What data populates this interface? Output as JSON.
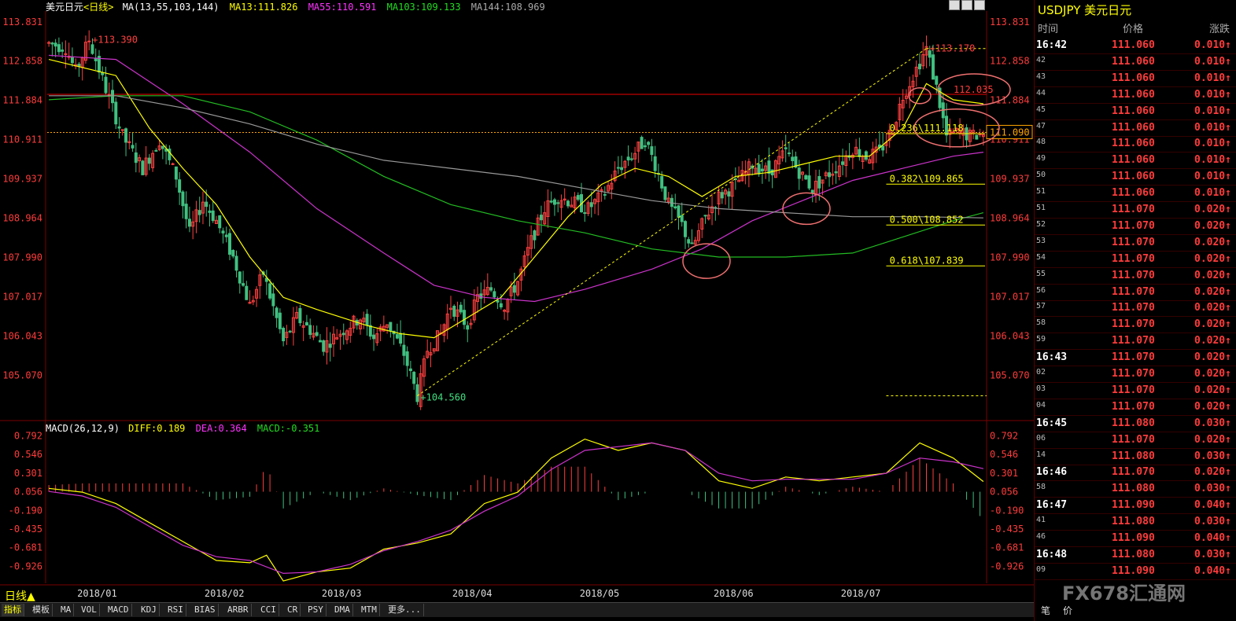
{
  "header": {
    "title": "美元日元",
    "period_tag": "<日线>",
    "ma_label": "MA(13,55,103,144)",
    "ma13": "MA13:111.826",
    "ma55": "MA55:110.591",
    "ma103": "MA103:109.133",
    "ma144": "MA144:108.969"
  },
  "macd_header": {
    "label": "MACD(26,12,9)",
    "diff": "DIFF:0.189",
    "dea": "DEA:0.364",
    "macd": "MACD:-0.351"
  },
  "colors": {
    "up": "#ff4040",
    "down": "#40c080",
    "ma13": "#ffff00",
    "ma55": "#cc33cc",
    "ma103": "#22bb22",
    "ma144": "#999999",
    "fib": "#ffff00",
    "axis": "#ff3b3b"
  },
  "period_button": "日线▲",
  "bottom_tabs": [
    "指标",
    "模板",
    "MA",
    "VOL",
    "MACD",
    "KDJ",
    "RSI",
    "BIAS",
    "ARBR",
    "CCI",
    "CR",
    "PSY",
    "DMA",
    "MTM",
    "更多..."
  ],
  "right_panel": {
    "symbol": "USDJPY 美元日元",
    "head_time": "时间",
    "head_price": "价格",
    "head_change": "涨跌",
    "ticks": [
      {
        "time": "16:42",
        "price": "111.060",
        "chg": "0.010↑",
        "major": true
      },
      {
        "time": "42",
        "price": "111.060",
        "chg": "0.010↑"
      },
      {
        "time": "43",
        "price": "111.060",
        "chg": "0.010↑"
      },
      {
        "time": "44",
        "price": "111.060",
        "chg": "0.010↑"
      },
      {
        "time": "45",
        "price": "111.060",
        "chg": "0.010↑"
      },
      {
        "time": "47",
        "price": "111.060",
        "chg": "0.010↑"
      },
      {
        "time": "48",
        "price": "111.060",
        "chg": "0.010↑"
      },
      {
        "time": "49",
        "price": "111.060",
        "chg": "0.010↑"
      },
      {
        "time": "50",
        "price": "111.060",
        "chg": "0.010↑"
      },
      {
        "time": "51",
        "price": "111.060",
        "chg": "0.010↑"
      },
      {
        "time": "51",
        "price": "111.070",
        "chg": "0.020↑"
      },
      {
        "time": "52",
        "price": "111.070",
        "chg": "0.020↑"
      },
      {
        "time": "53",
        "price": "111.070",
        "chg": "0.020↑"
      },
      {
        "time": "54",
        "price": "111.070",
        "chg": "0.020↑"
      },
      {
        "time": "55",
        "price": "111.070",
        "chg": "0.020↑"
      },
      {
        "time": "56",
        "price": "111.070",
        "chg": "0.020↑"
      },
      {
        "time": "57",
        "price": "111.070",
        "chg": "0.020↑"
      },
      {
        "time": "58",
        "price": "111.070",
        "chg": "0.020↑"
      },
      {
        "time": "59",
        "price": "111.070",
        "chg": "0.020↑"
      },
      {
        "time": "16:43",
        "price": "111.070",
        "chg": "0.020↑",
        "major": true
      },
      {
        "time": "02",
        "price": "111.070",
        "chg": "0.020↑"
      },
      {
        "time": "03",
        "price": "111.070",
        "chg": "0.020↑"
      },
      {
        "time": "04",
        "price": "111.070",
        "chg": "0.020↑"
      },
      {
        "time": "16:45",
        "price": "111.080",
        "chg": "0.030↑",
        "major": true
      },
      {
        "time": "06",
        "price": "111.070",
        "chg": "0.020↑"
      },
      {
        "time": "14",
        "price": "111.080",
        "chg": "0.030↑"
      },
      {
        "time": "16:46",
        "price": "111.070",
        "chg": "0.020↑",
        "major": true
      },
      {
        "time": "58",
        "price": "111.080",
        "chg": "0.030↑"
      },
      {
        "time": "16:47",
        "price": "111.090",
        "chg": "0.040↑",
        "major": true
      },
      {
        "time": "41",
        "price": "111.080",
        "chg": "0.030↑"
      },
      {
        "time": "46",
        "price": "111.090",
        "chg": "0.040↑"
      },
      {
        "time": "16:48",
        "price": "111.080",
        "chg": "0.030↑",
        "major": true
      },
      {
        "time": "09",
        "price": "111.090",
        "chg": "0.040↑"
      }
    ],
    "bottom_left": "笔",
    "bottom_right": "价"
  },
  "watermark": "FX678汇通网",
  "chart_data": [
    {
      "type": "candlestick",
      "title": "美元日元<日线>",
      "y_ticks": [
        113.831,
        112.858,
        111.884,
        110.911,
        109.937,
        108.964,
        107.99,
        107.017,
        106.043,
        105.07
      ],
      "ylim": [
        104.2,
        114.1
      ],
      "x_ticks": [
        "2018/01",
        "2018/02",
        "2018/03",
        "2018/04",
        "2018/05",
        "2018/06",
        "2018/07"
      ],
      "x_tick_index": [
        5,
        43,
        78,
        117,
        155,
        195,
        233
      ],
      "n_bars": 268,
      "bar_colors": {
        "up": "#ff4040",
        "down": "#40c080"
      },
      "path": [
        [
          0,
          113.3
        ],
        [
          5,
          113.2
        ],
        [
          8,
          112.6
        ],
        [
          12,
          113.39
        ],
        [
          16,
          112.4
        ],
        [
          22,
          111.0
        ],
        [
          28,
          110.2
        ],
        [
          33,
          110.9
        ],
        [
          38,
          110.0
        ],
        [
          42,
          108.6
        ],
        [
          46,
          109.4
        ],
        [
          50,
          108.9
        ],
        [
          55,
          108.0
        ],
        [
          60,
          106.8
        ],
        [
          64,
          107.6
        ],
        [
          70,
          105.9
        ],
        [
          74,
          106.5
        ],
        [
          78,
          106.2
        ],
        [
          82,
          105.8
        ],
        [
          88,
          106.2
        ],
        [
          93,
          106.5
        ],
        [
          97,
          106.0
        ],
        [
          101,
          106.4
        ],
        [
          106,
          105.6
        ],
        [
          110,
          104.56
        ],
        [
          113,
          105.7
        ],
        [
          117,
          106.1
        ],
        [
          120,
          106.8
        ],
        [
          125,
          106.3
        ],
        [
          128,
          107.0
        ],
        [
          132,
          107.2
        ],
        [
          136,
          106.8
        ],
        [
          140,
          107.4
        ],
        [
          144,
          108.4
        ],
        [
          148,
          109.2
        ],
        [
          152,
          109.5
        ],
        [
          158,
          109.3
        ],
        [
          161,
          109.2
        ],
        [
          166,
          109.6
        ],
        [
          170,
          110.2
        ],
        [
          175,
          110.6
        ],
        [
          178,
          110.9
        ],
        [
          181,
          110.3
        ],
        [
          185,
          109.3
        ],
        [
          189,
          108.8
        ],
        [
          192,
          108.2
        ],
        [
          196,
          109.0
        ],
        [
          200,
          109.5
        ],
        [
          205,
          109.8
        ],
        [
          210,
          110.3
        ],
        [
          215,
          110.1
        ],
        [
          220,
          110.6
        ],
        [
          225,
          110.0
        ],
        [
          228,
          109.7
        ],
        [
          232,
          110.0
        ],
        [
          236,
          110.3
        ],
        [
          240,
          110.7
        ],
        [
          244,
          110.5
        ],
        [
          248,
          110.6
        ],
        [
          252,
          111.2
        ],
        [
          255,
          112.0
        ],
        [
          258,
          112.5
        ],
        [
          262,
          113.17
        ],
        [
          265,
          112.2
        ],
        [
          268,
          111.0
        ],
        [
          272,
          111.1
        ],
        [
          275,
          111.0
        ],
        [
          279,
          111.06
        ]
      ],
      "highs_lows_labels": [
        {
          "text": "113.390",
          "value": 113.39,
          "index": 12
        },
        {
          "text": "104.560",
          "value": 104.56,
          "index": 110
        },
        {
          "text": "113.170",
          "value": 113.17,
          "index": 262
        }
      ],
      "current_price_label": "111.090",
      "current_price": 111.09,
      "horizontal_red_line": 112.035,
      "fib_levels": [
        {
          "label": "0.236\\111.118",
          "value": 111.118
        },
        {
          "label": "0.382\\109.865",
          "value": 109.865
        },
        {
          "label": "0.500\\108.852",
          "value": 108.852
        },
        {
          "label": "0.618\\107.839",
          "value": 107.839
        }
      ],
      "fib_base_value": 104.56,
      "annotation_circle_label": "112.035",
      "series": [
        {
          "name": "MA13",
          "color": "#ffff00",
          "values": [
            [
              0,
              112.9
            ],
            [
              20,
              112.5
            ],
            [
              30,
              111.2
            ],
            [
              40,
              110.2
            ],
            [
              50,
              109.3
            ],
            [
              60,
              108.0
            ],
            [
              70,
              107.0
            ],
            [
              80,
              106.7
            ],
            [
              95,
              106.3
            ],
            [
              105,
              106.1
            ],
            [
              115,
              106.0
            ],
            [
              125,
              106.5
            ],
            [
              135,
              107.0
            ],
            [
              145,
              108.0
            ],
            [
              155,
              109.0
            ],
            [
              165,
              109.8
            ],
            [
              175,
              110.2
            ],
            [
              185,
              110.0
            ],
            [
              195,
              109.5
            ],
            [
              205,
              110.0
            ],
            [
              215,
              110.1
            ],
            [
              225,
              110.3
            ],
            [
              235,
              110.5
            ],
            [
              245,
              110.5
            ],
            [
              255,
              111.2
            ],
            [
              262,
              112.3
            ],
            [
              270,
              111.9
            ],
            [
              279,
              111.8
            ]
          ]
        },
        {
          "name": "MA55",
          "color": "#cc33cc",
          "values": [
            [
              0,
              113.0
            ],
            [
              20,
              112.9
            ],
            [
              40,
              111.8
            ],
            [
              60,
              110.6
            ],
            [
              80,
              109.2
            ],
            [
              100,
              108.1
            ],
            [
              115,
              107.3
            ],
            [
              130,
              107.0
            ],
            [
              145,
              106.9
            ],
            [
              160,
              107.2
            ],
            [
              180,
              107.7
            ],
            [
              195,
              108.2
            ],
            [
              210,
              108.9
            ],
            [
              225,
              109.4
            ],
            [
              240,
              109.9
            ],
            [
              255,
              110.2
            ],
            [
              270,
              110.5
            ],
            [
              279,
              110.6
            ]
          ]
        },
        {
          "name": "MA103",
          "color": "#22bb22",
          "values": [
            [
              0,
              111.9
            ],
            [
              20,
              112.0
            ],
            [
              40,
              112.0
            ],
            [
              60,
              111.6
            ],
            [
              80,
              110.9
            ],
            [
              100,
              110.0
            ],
            [
              120,
              109.3
            ],
            [
              140,
              108.9
            ],
            [
              160,
              108.6
            ],
            [
              180,
              108.2
            ],
            [
              200,
              108.0
            ],
            [
              220,
              108.0
            ],
            [
              240,
              108.1
            ],
            [
              255,
              108.5
            ],
            [
              270,
              108.9
            ],
            [
              279,
              109.1
            ]
          ]
        },
        {
          "name": "MA144",
          "color": "#999999",
          "values": [
            [
              0,
              112.0
            ],
            [
              20,
              112.0
            ],
            [
              40,
              111.7
            ],
            [
              60,
              111.3
            ],
            [
              80,
              110.8
            ],
            [
              100,
              110.4
            ],
            [
              120,
              110.2
            ],
            [
              140,
              110.0
            ],
            [
              160,
              109.7
            ],
            [
              180,
              109.4
            ],
            [
              200,
              109.2
            ],
            [
              220,
              109.1
            ],
            [
              240,
              109.0
            ],
            [
              260,
              109.0
            ],
            [
              279,
              108.97
            ]
          ]
        }
      ]
    },
    {
      "type": "macd",
      "title": "MACD(26,12,9)",
      "y_ticks": [
        0.792,
        0.546,
        0.301,
        0.056,
        -0.19,
        -0.435,
        -0.681,
        -0.926
      ],
      "ylim": [
        -1.15,
        0.88
      ],
      "series": [
        {
          "name": "DIFF",
          "color": "#ffff00",
          "values": [
            [
              0,
              0.1
            ],
            [
              10,
              0.05
            ],
            [
              20,
              -0.1
            ],
            [
              30,
              -0.35
            ],
            [
              40,
              -0.6
            ],
            [
              50,
              -0.85
            ],
            [
              60,
              -0.88
            ],
            [
              65,
              -0.78
            ],
            [
              70,
              -1.12
            ],
            [
              80,
              -1.0
            ],
            [
              90,
              -0.95
            ],
            [
              100,
              -0.7
            ],
            [
              110,
              -0.62
            ],
            [
              120,
              -0.5
            ],
            [
              130,
              -0.1
            ],
            [
              140,
              0.05
            ],
            [
              150,
              0.5
            ],
            [
              160,
              0.75
            ],
            [
              170,
              0.6
            ],
            [
              180,
              0.7
            ],
            [
              190,
              0.6
            ],
            [
              200,
              0.2
            ],
            [
              210,
              0.1
            ],
            [
              220,
              0.25
            ],
            [
              230,
              0.2
            ],
            [
              240,
              0.25
            ],
            [
              250,
              0.3
            ],
            [
              260,
              0.7
            ],
            [
              270,
              0.5
            ],
            [
              279,
              0.19
            ]
          ]
        },
        {
          "name": "DEA",
          "color": "#cc33cc",
          "values": [
            [
              0,
              0.06
            ],
            [
              10,
              0.0
            ],
            [
              20,
              -0.15
            ],
            [
              30,
              -0.4
            ],
            [
              40,
              -0.65
            ],
            [
              50,
              -0.8
            ],
            [
              60,
              -0.85
            ],
            [
              70,
              -1.02
            ],
            [
              80,
              -1.0
            ],
            [
              90,
              -0.9
            ],
            [
              100,
              -0.72
            ],
            [
              110,
              -0.6
            ],
            [
              120,
              -0.45
            ],
            [
              130,
              -0.2
            ],
            [
              140,
              0.0
            ],
            [
              150,
              0.35
            ],
            [
              160,
              0.6
            ],
            [
              170,
              0.65
            ],
            [
              180,
              0.7
            ],
            [
              190,
              0.6
            ],
            [
              200,
              0.3
            ],
            [
              210,
              0.2
            ],
            [
              220,
              0.22
            ],
            [
              230,
              0.22
            ],
            [
              240,
              0.22
            ],
            [
              250,
              0.3
            ],
            [
              260,
              0.5
            ],
            [
              270,
              0.45
            ],
            [
              279,
              0.36
            ]
          ]
        },
        {
          "name": "MACD",
          "color_pos": "#ff4040",
          "color_neg": "#40c080",
          "from_diff_dea": true
        }
      ]
    }
  ]
}
